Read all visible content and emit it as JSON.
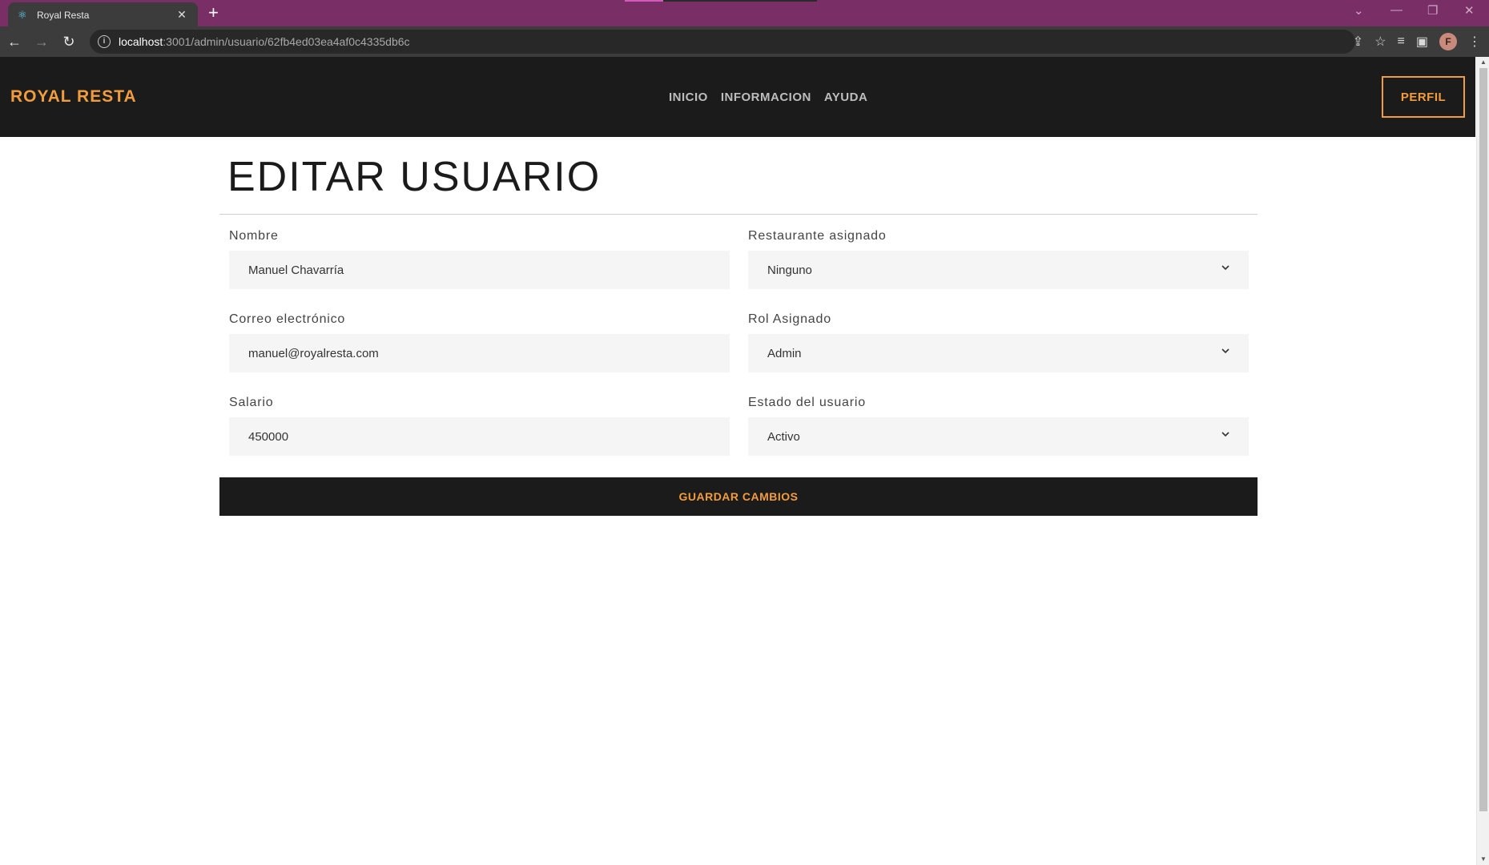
{
  "browser": {
    "tab_title": "Royal Resta",
    "tab_close": "✕",
    "new_tab": "+",
    "url_host": "localhost",
    "url_path": ":3001/admin/usuario/62fb4ed03ea4af0c4335db6c",
    "profile_initial": "F"
  },
  "navbar": {
    "brand": "ROYAL RESTA",
    "links": [
      "INICIO",
      "INFORMACION",
      "AYUDA"
    ],
    "profile_button": "PERFIL"
  },
  "form": {
    "title": "EDITAR USUARIO",
    "fields": {
      "nombre": {
        "label": "Nombre",
        "value": "Manuel Chavarría"
      },
      "correo": {
        "label": "Correo electrónico",
        "value": "manuel@royalresta.com"
      },
      "salario": {
        "label": "Salario",
        "value": "450000"
      },
      "restaurante": {
        "label": "Restaurante asignado",
        "value": "Ninguno"
      },
      "rol": {
        "label": "Rol Asignado",
        "value": "Admin"
      },
      "estado": {
        "label": "Estado del usuario",
        "value": "Activo"
      }
    },
    "save_button": "GUARDAR CAMBIOS"
  },
  "colors": {
    "accent": "#f39c3c",
    "navbar_bg": "#1b1b1b",
    "tabbar_bg": "#7a2e66",
    "field_bg": "#f5f5f6"
  }
}
